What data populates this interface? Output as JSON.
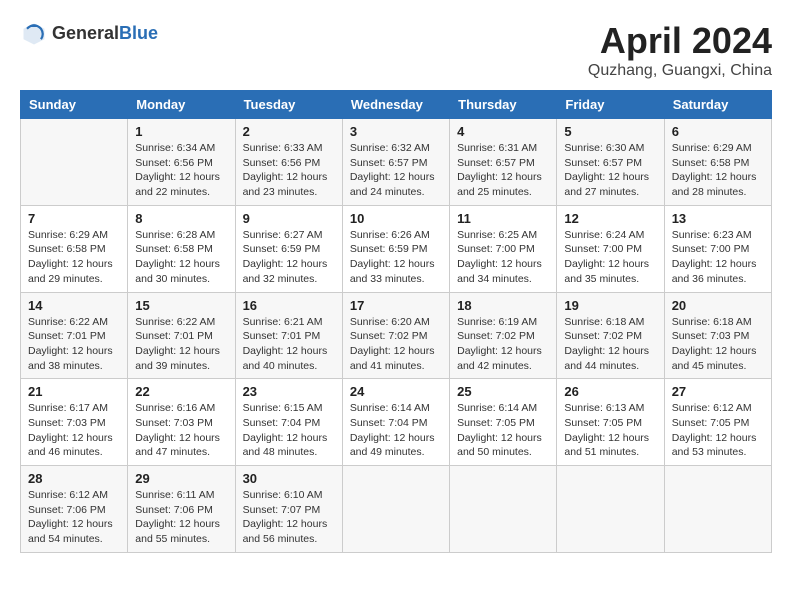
{
  "header": {
    "logo_general": "General",
    "logo_blue": "Blue",
    "month_title": "April 2024",
    "location": "Quzhang, Guangxi, China"
  },
  "calendar": {
    "days_of_week": [
      "Sunday",
      "Monday",
      "Tuesday",
      "Wednesday",
      "Thursday",
      "Friday",
      "Saturday"
    ],
    "weeks": [
      [
        {
          "day": "",
          "info": ""
        },
        {
          "day": "1",
          "info": "Sunrise: 6:34 AM\nSunset: 6:56 PM\nDaylight: 12 hours\nand 22 minutes."
        },
        {
          "day": "2",
          "info": "Sunrise: 6:33 AM\nSunset: 6:56 PM\nDaylight: 12 hours\nand 23 minutes."
        },
        {
          "day": "3",
          "info": "Sunrise: 6:32 AM\nSunset: 6:57 PM\nDaylight: 12 hours\nand 24 minutes."
        },
        {
          "day": "4",
          "info": "Sunrise: 6:31 AM\nSunset: 6:57 PM\nDaylight: 12 hours\nand 25 minutes."
        },
        {
          "day": "5",
          "info": "Sunrise: 6:30 AM\nSunset: 6:57 PM\nDaylight: 12 hours\nand 27 minutes."
        },
        {
          "day": "6",
          "info": "Sunrise: 6:29 AM\nSunset: 6:58 PM\nDaylight: 12 hours\nand 28 minutes."
        }
      ],
      [
        {
          "day": "7",
          "info": "Sunrise: 6:29 AM\nSunset: 6:58 PM\nDaylight: 12 hours\nand 29 minutes."
        },
        {
          "day": "8",
          "info": "Sunrise: 6:28 AM\nSunset: 6:58 PM\nDaylight: 12 hours\nand 30 minutes."
        },
        {
          "day": "9",
          "info": "Sunrise: 6:27 AM\nSunset: 6:59 PM\nDaylight: 12 hours\nand 32 minutes."
        },
        {
          "day": "10",
          "info": "Sunrise: 6:26 AM\nSunset: 6:59 PM\nDaylight: 12 hours\nand 33 minutes."
        },
        {
          "day": "11",
          "info": "Sunrise: 6:25 AM\nSunset: 7:00 PM\nDaylight: 12 hours\nand 34 minutes."
        },
        {
          "day": "12",
          "info": "Sunrise: 6:24 AM\nSunset: 7:00 PM\nDaylight: 12 hours\nand 35 minutes."
        },
        {
          "day": "13",
          "info": "Sunrise: 6:23 AM\nSunset: 7:00 PM\nDaylight: 12 hours\nand 36 minutes."
        }
      ],
      [
        {
          "day": "14",
          "info": "Sunrise: 6:22 AM\nSunset: 7:01 PM\nDaylight: 12 hours\nand 38 minutes."
        },
        {
          "day": "15",
          "info": "Sunrise: 6:22 AM\nSunset: 7:01 PM\nDaylight: 12 hours\nand 39 minutes."
        },
        {
          "day": "16",
          "info": "Sunrise: 6:21 AM\nSunset: 7:01 PM\nDaylight: 12 hours\nand 40 minutes."
        },
        {
          "day": "17",
          "info": "Sunrise: 6:20 AM\nSunset: 7:02 PM\nDaylight: 12 hours\nand 41 minutes."
        },
        {
          "day": "18",
          "info": "Sunrise: 6:19 AM\nSunset: 7:02 PM\nDaylight: 12 hours\nand 42 minutes."
        },
        {
          "day": "19",
          "info": "Sunrise: 6:18 AM\nSunset: 7:02 PM\nDaylight: 12 hours\nand 44 minutes."
        },
        {
          "day": "20",
          "info": "Sunrise: 6:18 AM\nSunset: 7:03 PM\nDaylight: 12 hours\nand 45 minutes."
        }
      ],
      [
        {
          "day": "21",
          "info": "Sunrise: 6:17 AM\nSunset: 7:03 PM\nDaylight: 12 hours\nand 46 minutes."
        },
        {
          "day": "22",
          "info": "Sunrise: 6:16 AM\nSunset: 7:03 PM\nDaylight: 12 hours\nand 47 minutes."
        },
        {
          "day": "23",
          "info": "Sunrise: 6:15 AM\nSunset: 7:04 PM\nDaylight: 12 hours\nand 48 minutes."
        },
        {
          "day": "24",
          "info": "Sunrise: 6:14 AM\nSunset: 7:04 PM\nDaylight: 12 hours\nand 49 minutes."
        },
        {
          "day": "25",
          "info": "Sunrise: 6:14 AM\nSunset: 7:05 PM\nDaylight: 12 hours\nand 50 minutes."
        },
        {
          "day": "26",
          "info": "Sunrise: 6:13 AM\nSunset: 7:05 PM\nDaylight: 12 hours\nand 51 minutes."
        },
        {
          "day": "27",
          "info": "Sunrise: 6:12 AM\nSunset: 7:05 PM\nDaylight: 12 hours\nand 53 minutes."
        }
      ],
      [
        {
          "day": "28",
          "info": "Sunrise: 6:12 AM\nSunset: 7:06 PM\nDaylight: 12 hours\nand 54 minutes."
        },
        {
          "day": "29",
          "info": "Sunrise: 6:11 AM\nSunset: 7:06 PM\nDaylight: 12 hours\nand 55 minutes."
        },
        {
          "day": "30",
          "info": "Sunrise: 6:10 AM\nSunset: 7:07 PM\nDaylight: 12 hours\nand 56 minutes."
        },
        {
          "day": "",
          "info": ""
        },
        {
          "day": "",
          "info": ""
        },
        {
          "day": "",
          "info": ""
        },
        {
          "day": "",
          "info": ""
        }
      ]
    ]
  }
}
